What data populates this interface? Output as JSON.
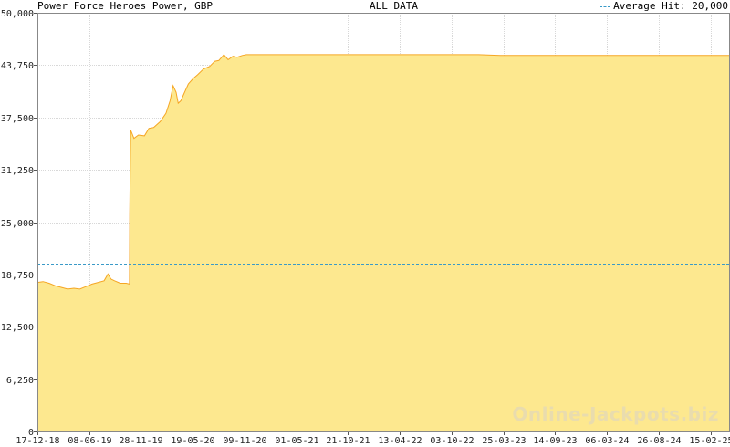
{
  "chart_data": {
    "type": "area",
    "title": "Power Force Heroes Power, GBP",
    "subtitle": "ALL DATA",
    "legend": {
      "label": "Average Hit: 20,000",
      "value": 20000,
      "placement": "top-right",
      "color": "#3a9ac8"
    },
    "watermark": "Online-Jackpots.biz",
    "y_ticks": [
      0,
      6250,
      12500,
      18750,
      25000,
      31250,
      37500,
      43750,
      50000
    ],
    "y_tick_labels": [
      "0",
      "6,250",
      "12,500",
      "18,750",
      "25,000",
      "31,250",
      "37,500",
      "43,750",
      "50,000"
    ],
    "ylim": [
      0,
      50000
    ],
    "x_ticks": [
      "17-12-18",
      "08-06-19",
      "28-11-19",
      "19-05-20",
      "09-11-20",
      "01-05-21",
      "21-10-21",
      "13-04-22",
      "03-10-22",
      "25-03-23",
      "14-09-23",
      "06-03-24",
      "26-08-24",
      "15-02-25"
    ],
    "xlim": [
      "17-12-18",
      "21-04-25"
    ],
    "grid": true,
    "fill_color": "#fde88f",
    "line_color": "#f5a623",
    "series": [
      {
        "x": [
          "17-12-18",
          "05-01-19",
          "25-01-19",
          "15-02-19",
          "08-03-19",
          "28-03-19",
          "18-04-19",
          "08-05-19",
          "28-05-19",
          "18-06-19",
          "08-07-19",
          "28-07-19",
          "10-08-19",
          "20-08-19",
          "01-09-19",
          "20-09-19",
          "10-10-19",
          "21-10-19",
          "22-10-19",
          "25-10-19",
          "05-11-19",
          "20-11-19",
          "10-12-19",
          "25-12-19",
          "10-01-20",
          "01-02-20",
          "20-02-20",
          "05-03-20",
          "15-03-20",
          "25-03-20",
          "01-04-20",
          "10-04-20",
          "20-04-20",
          "05-05-20",
          "20-05-20",
          "05-06-20",
          "25-06-20",
          "15-07-20",
          "01-08-20",
          "15-08-20",
          "01-09-20",
          "15-09-20",
          "01-10-20",
          "15-10-20",
          "01-11-20",
          "15-11-20",
          "01-01-21",
          "01-06-21",
          "01-01-22",
          "01-06-22",
          "01-01-23",
          "15-03-23",
          "01-04-23",
          "01-01-24",
          "01-01-25",
          "21-04-25"
        ],
        "values": [
          17800,
          17900,
          17700,
          17400,
          17200,
          17000,
          17100,
          17000,
          17300,
          17600,
          17800,
          18000,
          18800,
          18200,
          18000,
          17700,
          17700,
          17600,
          26000,
          36000,
          35000,
          35400,
          35300,
          36200,
          36300,
          37000,
          38000,
          39500,
          41300,
          40500,
          39200,
          39500,
          40300,
          41500,
          42100,
          42600,
          43300,
          43600,
          44200,
          44300,
          45000,
          44400,
          44800,
          44700,
          44900,
          45000,
          45000,
          45000,
          45000,
          45000,
          45000,
          44900,
          44900,
          44900,
          44900,
          44900
        ]
      }
    ]
  }
}
